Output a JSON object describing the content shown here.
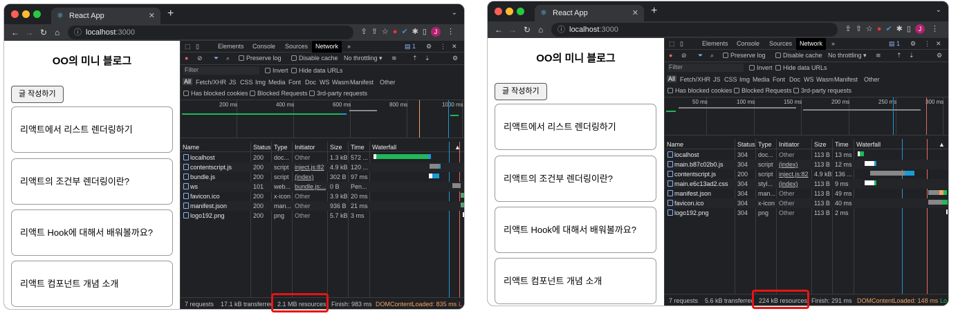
{
  "browser": {
    "tab_title": "React App",
    "url_host": "localhost",
    "url_port": ":3000",
    "avatar_letter": "J"
  },
  "page": {
    "title": "OO의 미니 블로그",
    "write_button": "글 작성하기",
    "posts": [
      "리액트에서 리스트 렌더링하기",
      "리액트의 조건부 렌더링이란?",
      "리액트 Hook에 대해서 배워볼까요?",
      "리액트 컴포넌트 개념 소개"
    ]
  },
  "devtools": {
    "tabs": [
      "Elements",
      "Console",
      "Sources",
      "Network"
    ],
    "active_tab": "Network",
    "more": "»",
    "issue_count": "1",
    "preserve_log": "Preserve log",
    "disable_cache": "Disable cache",
    "throttling": "No throttling",
    "filter_placeholder": "Filter",
    "invert": "Invert",
    "hide_data_urls": "Hide data URLs",
    "type_filters": [
      "All",
      "Fetch/XHR",
      "JS",
      "CSS",
      "Img",
      "Media",
      "Font",
      "Doc",
      "WS",
      "Wasm",
      "Manifest",
      "Other"
    ],
    "has_blocked_cookies": "Has blocked cookies",
    "blocked_requests": "Blocked Requests",
    "third_party": "3rd-party requests",
    "columns": [
      "Name",
      "Status",
      "Type",
      "Initiator",
      "Size",
      "Time",
      "Waterfall"
    ]
  },
  "left": {
    "ticks": [
      "200 ms",
      "400 ms",
      "600 ms",
      "800 ms",
      "1000 ms"
    ],
    "requests": [
      {
        "name": "localhost",
        "status": "200",
        "type": "doc...",
        "initiator": "Other",
        "size": "1.3 kB",
        "time": "572 ..."
      },
      {
        "name": "contentscript.js",
        "status": "200",
        "type": "script",
        "initiator": "inject.js:82",
        "size": "4.9 kB",
        "time": "120 ..."
      },
      {
        "name": "bundle.js",
        "status": "200",
        "type": "script",
        "initiator": "(index)",
        "size": "302 B",
        "time": "97 ms"
      },
      {
        "name": "ws",
        "status": "101",
        "type": "web...",
        "initiator": "bundle.js:...",
        "size": "0 B",
        "time": "Pen..."
      },
      {
        "name": "favicon.ico",
        "status": "200",
        "type": "x-icon",
        "initiator": "Other",
        "size": "3.9 kB",
        "time": "20 ms"
      },
      {
        "name": "manifest.json",
        "status": "200",
        "type": "man...",
        "initiator": "Other",
        "size": "936 B",
        "time": "21 ms"
      },
      {
        "name": "logo192.png",
        "status": "200",
        "type": "png",
        "initiator": "Other",
        "size": "5.7 kB",
        "time": "3 ms"
      }
    ],
    "summary": {
      "requests": "7 requests",
      "transferred": "17.1 kB transferred",
      "resources": "2.1 MB resources",
      "finish": "Finish: 983 ms",
      "dcl": "DOMContentLoaded: 835 ms",
      "load": "L"
    }
  },
  "right": {
    "ticks": [
      "50 ms",
      "100 ms",
      "150 ms",
      "200 ms",
      "250 ms",
      "300 ms"
    ],
    "requests": [
      {
        "name": "localhost",
        "status": "304",
        "type": "doc...",
        "initiator": "Other",
        "size": "113 B",
        "time": "13 ms"
      },
      {
        "name": "main.b87c02b0.js",
        "status": "304",
        "type": "script",
        "initiator": "(index)",
        "size": "113 B",
        "time": "12 ms"
      },
      {
        "name": "contentscript.js",
        "status": "200",
        "type": "script",
        "initiator": "inject.js:82",
        "size": "4.9 kB",
        "time": "136 ..."
      },
      {
        "name": "main.e6c13ad2.css",
        "status": "304",
        "type": "styl...",
        "initiator": "(index)",
        "size": "113 B",
        "time": "9 ms"
      },
      {
        "name": "manifest.json",
        "status": "304",
        "type": "man...",
        "initiator": "Other",
        "size": "113 B",
        "time": "49 ms"
      },
      {
        "name": "favicon.ico",
        "status": "304",
        "type": "x-icon",
        "initiator": "Other",
        "size": "113 B",
        "time": "40 ms"
      },
      {
        "name": "logo192.png",
        "status": "304",
        "type": "png",
        "initiator": "Other",
        "size": "113 B",
        "time": "2 ms"
      }
    ],
    "summary": {
      "requests": "7 requests",
      "transferred": "5.6 kB transferred",
      "resources": "224 kB resources",
      "finish": "Finish: 291 ms",
      "dcl": "DOMContentLoaded: 148 ms",
      "load": "Lo"
    }
  },
  "colors": {
    "highlight": "#e51515",
    "dcl": "#f4a261",
    "waterfall_green": "#1fb85a",
    "waterfall_blue": "#1a9bd7"
  }
}
